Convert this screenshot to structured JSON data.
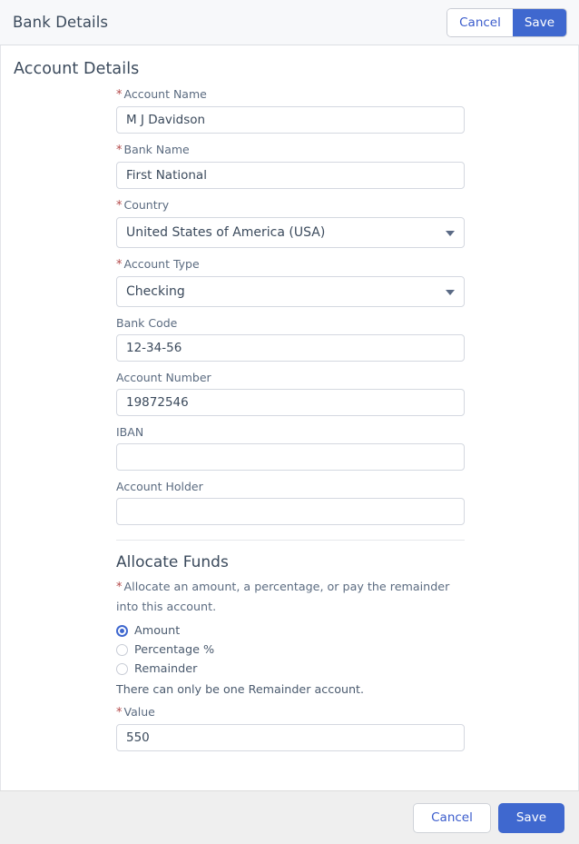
{
  "header": {
    "title": "Bank Details",
    "cancel_label": "Cancel",
    "save_label": "Save"
  },
  "account_details": {
    "section_title": "Account Details",
    "fields": [
      {
        "label": "Account Name",
        "required": true,
        "value": "M J Davidson",
        "type": "text"
      },
      {
        "label": "Bank Name",
        "required": true,
        "value": "First National",
        "type": "text"
      },
      {
        "label": "Country",
        "required": true,
        "value": "United States of America (USA)",
        "type": "select"
      },
      {
        "label": "Account Type",
        "required": true,
        "value": "Checking",
        "type": "select"
      },
      {
        "label": "Bank Code",
        "required": false,
        "value": "12-34-56",
        "type": "text"
      },
      {
        "label": "Account Number",
        "required": false,
        "value": "19872546",
        "type": "text"
      },
      {
        "label": "IBAN",
        "required": false,
        "value": "",
        "type": "text"
      },
      {
        "label": "Account Holder",
        "required": false,
        "value": "",
        "type": "text"
      }
    ]
  },
  "allocate_funds": {
    "title": "Allocate Funds",
    "description": "Allocate an amount, a percentage, or pay the remainder into this account.",
    "description_required": true,
    "options": [
      {
        "label": "Amount",
        "selected": true
      },
      {
        "label": "Percentage %",
        "selected": false
      },
      {
        "label": "Remainder",
        "selected": false
      }
    ],
    "note": "There can only be one Remainder account.",
    "value_label": "Value",
    "value_required": true,
    "value": "550"
  },
  "footer": {
    "cancel_label": "Cancel",
    "save_label": "Save"
  },
  "icons": {
    "dropdown": "chevron-down-icon",
    "required_marker": "asterisk-icon"
  },
  "colors": {
    "accent": "#3f68cf",
    "link": "#3b5ccc",
    "required": "#b44a4a",
    "header_bg": "#f7f8fa",
    "footer_bg": "#efefef",
    "text": "#3b4a5c",
    "label": "#5b6b80",
    "border": "#d4d8e0"
  }
}
